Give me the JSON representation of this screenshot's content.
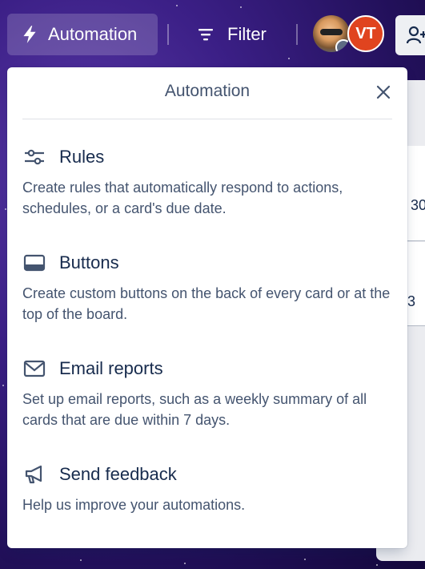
{
  "header": {
    "automation_label": "Automation",
    "filter_label": "Filter",
    "avatar_initials": "VT"
  },
  "popover": {
    "title": "Automation",
    "items": [
      {
        "label": "Rules",
        "icon": "sliders-icon",
        "description": "Create rules that automatically respond to actions, schedules, or a card's due date."
      },
      {
        "label": "Buttons",
        "icon": "button-icon",
        "description": "Create custom buttons on the back of every card or at the top of the board."
      },
      {
        "label": "Email reports",
        "icon": "envelope-icon",
        "description": "Set up email reports, such as a weekly summary of all cards that are due within 7 days."
      },
      {
        "label": "Send feedback",
        "icon": "megaphone-icon",
        "description": "Help us improve your automations."
      }
    ]
  },
  "background": {
    "card_fragment_1": "30",
    "card_fragment_2": "/ 3"
  },
  "colors": {
    "avatar_vt": "#e0441f",
    "popover_bg": "#ffffff",
    "text_primary": "#172b4d",
    "text_secondary": "#44546f"
  }
}
